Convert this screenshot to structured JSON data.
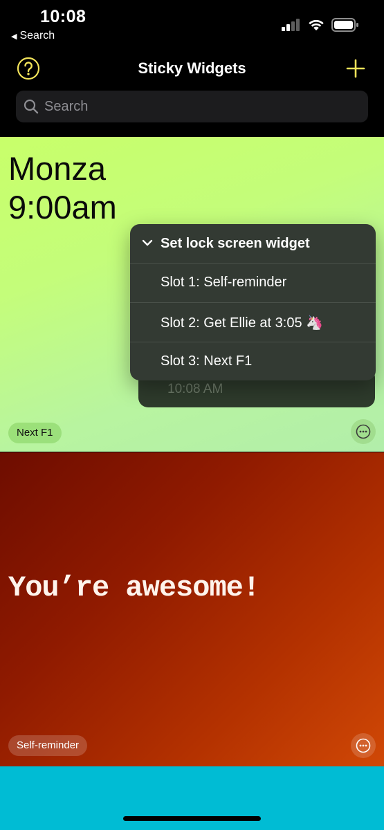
{
  "status_bar": {
    "time": "10:08",
    "back_label": "Search",
    "back_chevron": "◀",
    "icons": [
      "cellular-signal-icon",
      "wifi-icon",
      "battery-icon"
    ]
  },
  "nav": {
    "title": "Sticky Widgets",
    "help_icon": "question-circle-icon",
    "add_icon": "plus-icon",
    "accent_color": "#f2e35a"
  },
  "search": {
    "placeholder": "Search"
  },
  "cards": [
    {
      "lines": [
        "Monza",
        "9:00am"
      ],
      "tag": "Next F1",
      "background": "#c4fd7a"
    },
    {
      "text": "You’re awesome!",
      "tag": "Self-reminder",
      "background": "#a12500"
    },
    {
      "background": "#00bcd4"
    }
  ],
  "context_menu": {
    "title": "Set lock screen widget",
    "items": [
      "Slot 1: Self-reminder",
      "Slot 2: Get Ellie at 3:05 🦄",
      "Slot 3: Next F1"
    ]
  },
  "time_chip": {
    "time": "10:08 AM"
  }
}
